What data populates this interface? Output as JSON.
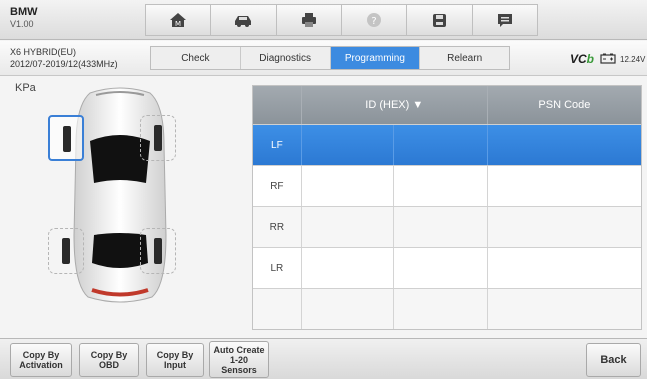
{
  "app": {
    "name": "BMW",
    "version": "V1.00"
  },
  "toolbar": {
    "icons": [
      "home-icon",
      "car-icon",
      "print-icon",
      "help-icon",
      "save-icon",
      "message-icon"
    ]
  },
  "vehicle": {
    "model": "X6 HYBRID(EU)",
    "years": "2012/07-2019/12(433MHz)"
  },
  "tabs": [
    {
      "label": "Check",
      "active": false
    },
    {
      "label": "Diagnostics",
      "active": false
    },
    {
      "label": "Programming",
      "active": true
    },
    {
      "label": "Relearn",
      "active": false
    }
  ],
  "status": {
    "vci": "VCI",
    "vci_b": "b",
    "voltage": "12.24V"
  },
  "main": {
    "unit": "KPa"
  },
  "table": {
    "headers": [
      "",
      "ID (HEX) ▼",
      "PSN Code"
    ],
    "rows": [
      {
        "pos": "LF",
        "selected": true
      },
      {
        "pos": "RF",
        "selected": false
      },
      {
        "pos": "RR",
        "selected": false
      },
      {
        "pos": "LR",
        "selected": false
      },
      {
        "pos": "",
        "selected": false
      }
    ]
  },
  "buttons": {
    "copy_activation": "Copy By\nActivation",
    "copy_obd": "Copy By\nOBD",
    "copy_input": "Copy By\nInput",
    "auto_create": "Auto Create\n1-20\nSensors",
    "back": "Back"
  },
  "colors": {
    "accent": "#3d8be0",
    "header": "#959da3"
  }
}
